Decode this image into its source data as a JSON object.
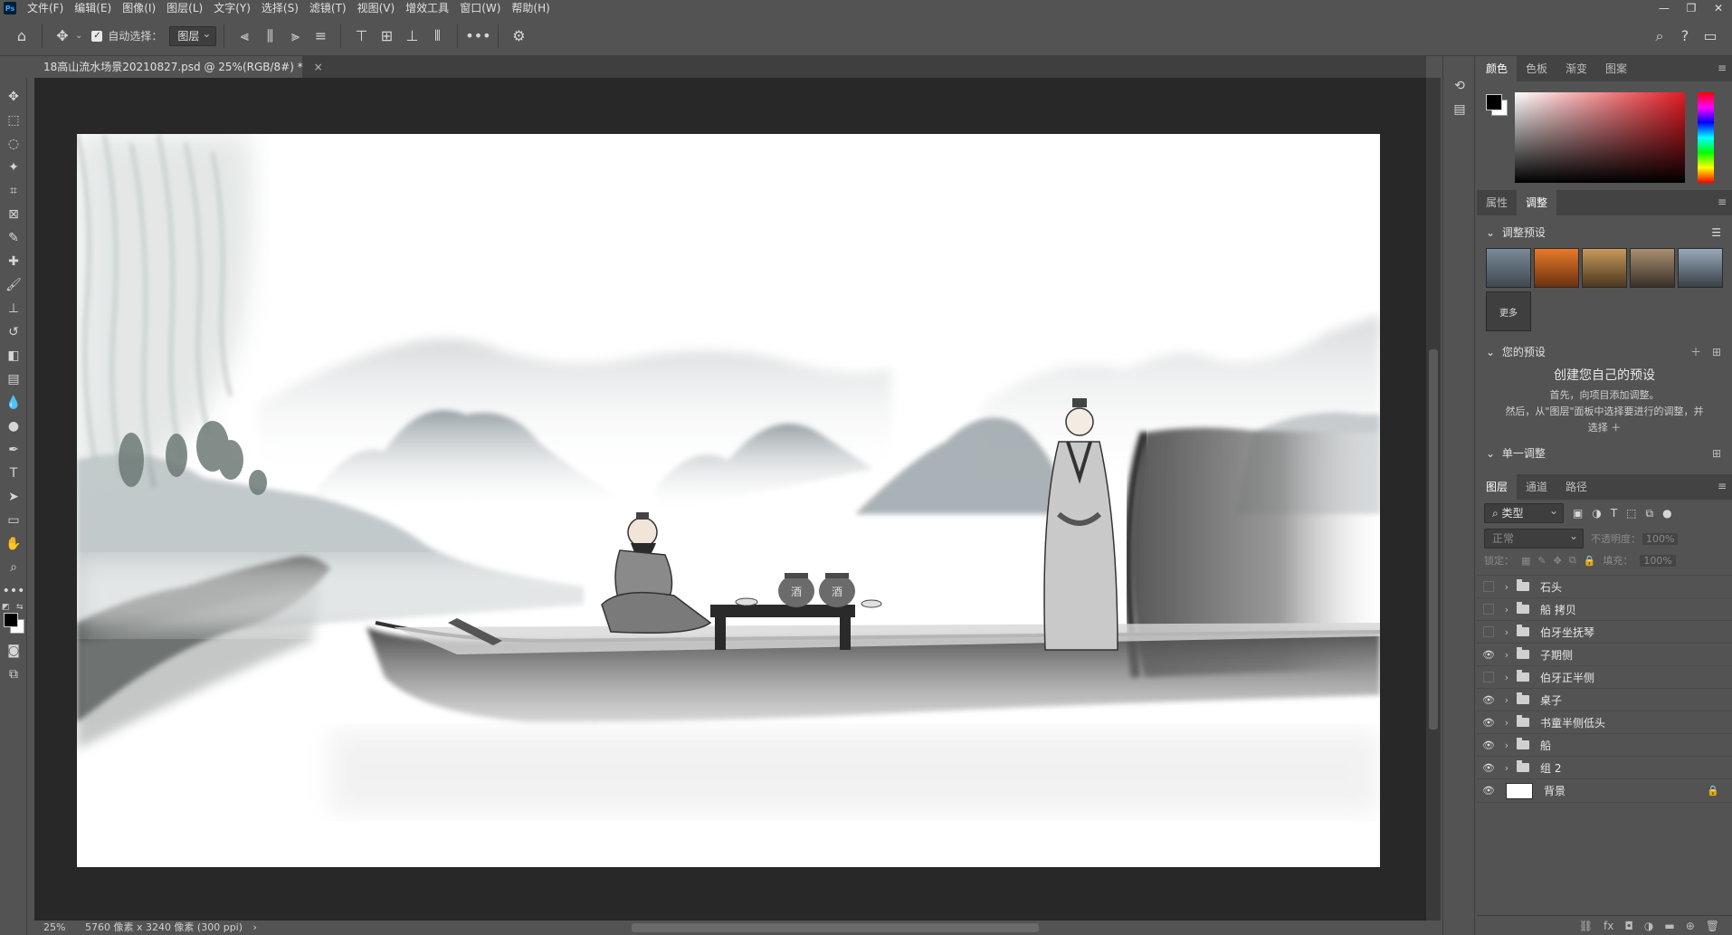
{
  "menu": {
    "items": [
      "文件(F)",
      "编辑(E)",
      "图像(I)",
      "图层(L)",
      "文字(Y)",
      "选择(S)",
      "滤镜(T)",
      "视图(V)",
      "增效工具",
      "窗口(W)",
      "帮助(H)"
    ],
    "logo": "Ps"
  },
  "options": {
    "auto_select_label": "自动选择：",
    "auto_select_target": "图层",
    "more": "•••"
  },
  "document": {
    "tab_title": "18高山流水场景20210827.psd @ 25%(RGB/8#) *",
    "close": "×"
  },
  "status": {
    "zoom": "25%",
    "dimensions": "5760 像素 x 3240 像素 (300 ppi)",
    "arrow": "›"
  },
  "color_panel": {
    "tabs": [
      "颜色",
      "色板",
      "渐变",
      "图案"
    ],
    "fg": "#000000",
    "bg": "#ffffff",
    "hue_color": "#e31b23"
  },
  "adjust_panel": {
    "tabs": [
      "属性",
      "调整"
    ],
    "presets_title": "调整预设",
    "more_label": "更多",
    "your_presets_title": "您的预设",
    "create_title": "创建您自己的预设",
    "create_line1": "首先，向项目添加调整。",
    "create_line2": "然后，从\"图层\"面板中选择要进行的调整，并",
    "create_line3": "选择 ＋",
    "single_adjust_title": "单一调整"
  },
  "layers_panel": {
    "tabs": [
      "图层",
      "通道",
      "路径"
    ],
    "filter_label": "类型",
    "blend_mode": "正常",
    "opacity_label": "不透明度：",
    "opacity_value": "100%",
    "lock_label": "锁定：",
    "fill_label": "填充：",
    "fill_value": "100%",
    "layers": [
      {
        "name": "石头",
        "visible": false,
        "type": "group"
      },
      {
        "name": "船 拷贝",
        "visible": false,
        "type": "group"
      },
      {
        "name": "伯牙坐抚琴",
        "visible": false,
        "type": "group"
      },
      {
        "name": "子期侧",
        "visible": true,
        "type": "group"
      },
      {
        "name": "伯牙正半侧",
        "visible": false,
        "type": "group"
      },
      {
        "name": "桌子",
        "visible": true,
        "type": "group"
      },
      {
        "name": "书童半侧低头",
        "visible": true,
        "type": "group"
      },
      {
        "name": "船",
        "visible": true,
        "type": "group"
      },
      {
        "name": "组 2",
        "visible": true,
        "type": "group"
      },
      {
        "name": "背景",
        "visible": true,
        "type": "background"
      }
    ],
    "footer_icons": [
      "link-icon",
      "fx-icon",
      "mask-icon",
      "adjustment-icon",
      "new-group-icon",
      "new-layer-icon",
      "trash-icon"
    ]
  },
  "jar_labels": [
    "酒",
    "酒"
  ]
}
